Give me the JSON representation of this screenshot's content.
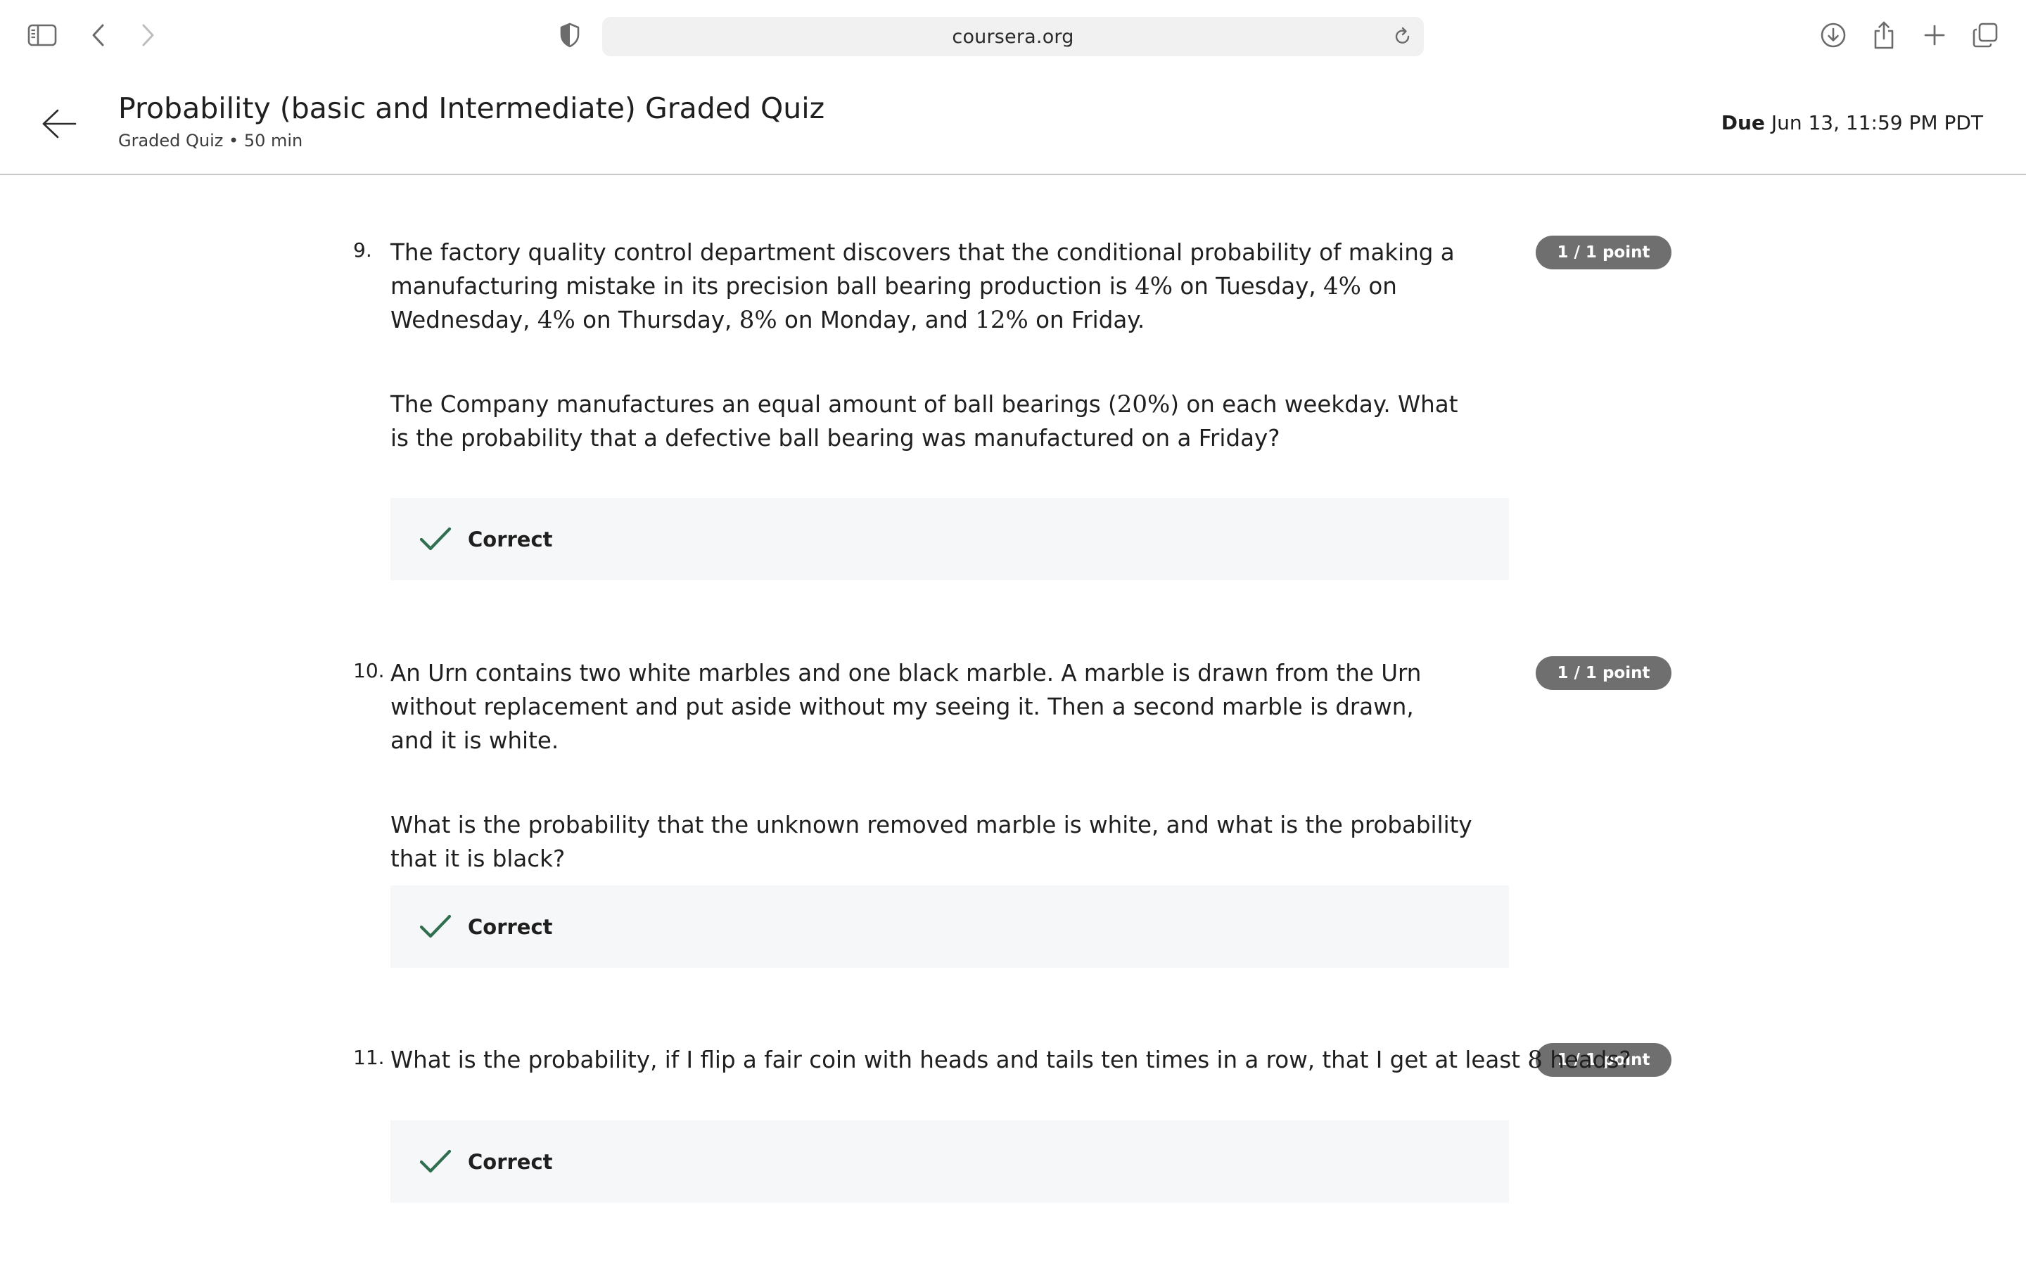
{
  "browser": {
    "url": "coursera.org",
    "icons": [
      "sidebar-icon",
      "back-icon",
      "forward-icon",
      "shield-icon",
      "reload-icon",
      "download-icon",
      "share-icon",
      "new-tab-icon",
      "tabs-overview-icon"
    ]
  },
  "header": {
    "title": "Probability (basic and Intermediate) Graded Quiz",
    "subtitle": "Graded Quiz • 50 min",
    "due_label": "Due",
    "due_value": " Jun 13, 11:59 PM PDT"
  },
  "questions": [
    {
      "number": "9.",
      "points": "1 / 1 point",
      "paragraph1": {
        "t1": "The factory quality control department discovers that the conditional probability of making a manufacturing mistake in its precision ball bearing production is ",
        "m1": "4%",
        "t2": " on Tuesday, ",
        "m2": "4%",
        "t3": " on Wednesday, ",
        "m3": "4%",
        "t4": " on Thursday, ",
        "m4": "8%",
        "t5": " on Monday, and ",
        "m5": "12%",
        "t6": " on Friday."
      },
      "paragraph2": {
        "t1": "The Company manufactures an equal amount of ball bearings (",
        "m1": "20%",
        "t2": ") on each weekday.  What is the probability that a defective ball bearing was manufactured on a Friday?"
      },
      "feedback": "Correct"
    },
    {
      "number": "10.",
      "points": "1 / 1 point",
      "paragraph1": "An Urn contains two white marbles and one black marble. A marble is drawn from the Urn without replacement and put aside without my seeing it. Then a second marble is drawn, and it is white.",
      "paragraph2": "What is the probability that the unknown removed marble is white, and what is the probability that it is black?",
      "feedback": "Correct"
    },
    {
      "number": "11.",
      "points": "1 / 1 point",
      "paragraph1": {
        "t1": "What is the probability, if I flip a fair coin with heads and tails ten times in a row, that I get at least ",
        "m1": "8",
        "t2": " heads?"
      },
      "feedback": "Correct"
    }
  ],
  "colors": {
    "check_green": "#2f6e4e",
    "badge_gray": "#6f6f6f",
    "feedback_bg": "#f5f7f8"
  }
}
